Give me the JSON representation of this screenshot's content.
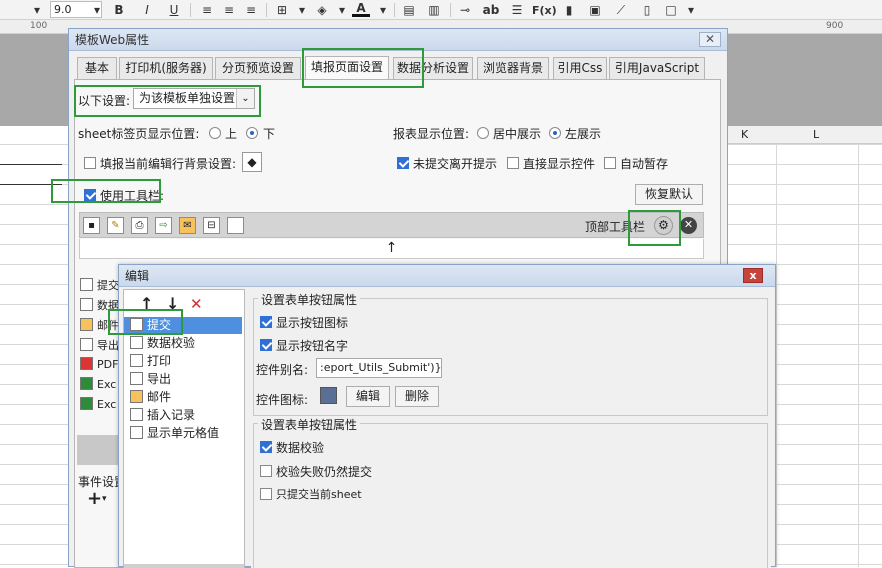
{
  "toolbar": {
    "font_size": "9.0",
    "bold": "B",
    "italic": "I",
    "underline": "U",
    "font_color_glyph": "A",
    "ab_glyph": "ab",
    "fx_glyph": "F(x)"
  },
  "ruler": {
    "mark_100": "100",
    "mark_900": "900"
  },
  "sheet_columns": {
    "k": "K",
    "l": "L"
  },
  "main_dialog": {
    "title": "模板Web属性",
    "close": "✕",
    "tabs": [
      {
        "label": "基本"
      },
      {
        "label": "打印机(服务器)"
      },
      {
        "label": "分页预览设置"
      },
      {
        "label": "填报页面设置"
      },
      {
        "label": "数据分析设置"
      },
      {
        "label": "浏览器背景"
      },
      {
        "label": "引用Css"
      },
      {
        "label": "引用JavaScript"
      }
    ],
    "active_tab": "填报页面设置",
    "settings_label": "以下设置:",
    "settings_value": "为该模板单独设置",
    "sheet_tab_position_label": "sheet标签页显示位置:",
    "sheet_tab_options": [
      "上",
      "下"
    ],
    "sheet_tab_selected": "下",
    "report_position_label": "报表显示位置:",
    "report_position_options": [
      "居中展示",
      "左展示"
    ],
    "report_position_selected": "左展示",
    "fill_edit_bg_label": "填报当前编辑行背景设置:",
    "fill_edit_bg_checked": false,
    "leave_prompt_label": "未提交离开提示",
    "leave_prompt_checked": true,
    "direct_show_label": "直接显示控件",
    "direct_show_checked": false,
    "auto_save_label": "自动暂存",
    "auto_save_checked": false,
    "use_toolbar_label": "使用工具栏:",
    "use_toolbar_checked": true,
    "restore_default": "恢复默认",
    "top_toolbar_label": "顶部工具栏",
    "arrow_glyph": "↑",
    "side_list": [
      "提交",
      "数据",
      "邮件",
      "导出",
      "PDF",
      "Exc",
      "Exc"
    ],
    "event_label": "事件设置",
    "add_glyph": "+"
  },
  "edit_dialog": {
    "title": "编辑",
    "close": "x",
    "up": "↑",
    "down": "↓",
    "delete": "✕",
    "items": [
      {
        "label": "提交",
        "icon": "floppy-icon"
      },
      {
        "label": "数据校验",
        "icon": "pencil-icon"
      },
      {
        "label": "打印",
        "icon": "printer-icon"
      },
      {
        "label": "导出",
        "icon": "export-icon"
      },
      {
        "label": "邮件",
        "icon": "mail-icon"
      },
      {
        "label": "插入记录",
        "icon": "insert-row-icon"
      },
      {
        "label": "显示单元格值",
        "icon": "cell-icon"
      }
    ],
    "selected_item": "提交",
    "group1_title": "设置表单按钮属性",
    "show_icon_label": "显示按钮图标",
    "show_icon_checked": true,
    "show_name_label": "显示按钮名字",
    "show_name_checked": true,
    "alias_label": "控件别名:",
    "alias_value": ":eport_Utils_Submit')}",
    "icon_label": "控件图标:",
    "edit_btn": "编辑",
    "delete_btn": "删除",
    "group2_title": "设置表单按钮属性",
    "validate_label": "数据校验",
    "validate_checked": true,
    "submit_on_fail_label": "校验失败仍然提交",
    "submit_on_fail_checked": false,
    "submit_current_sheet_label": "只提交当前sheet",
    "submit_current_sheet_checked": false
  },
  "colors": {
    "highlight": "#2f9a3a",
    "selection": "#4e8fe0",
    "close_red": "#c7443c"
  }
}
